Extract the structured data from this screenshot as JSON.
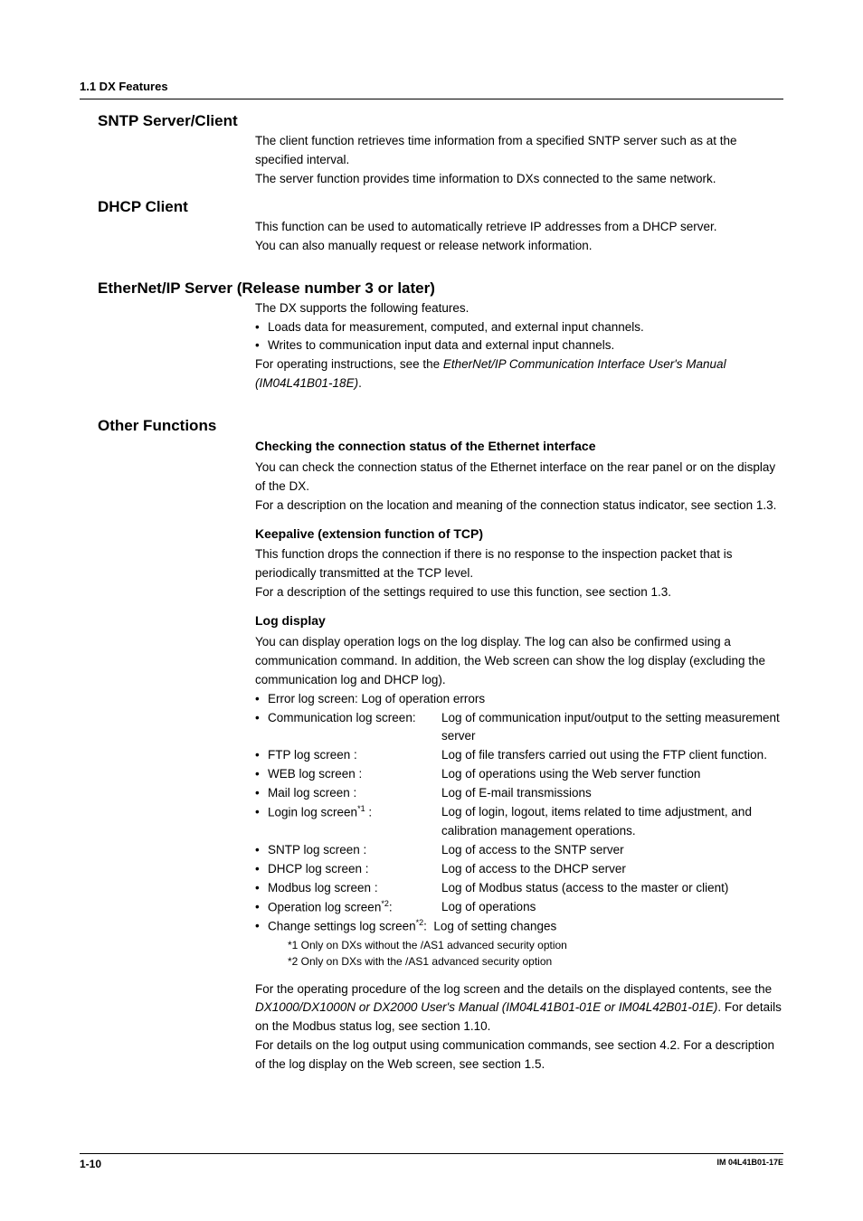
{
  "header": {
    "section_label": "1.1  DX Features"
  },
  "sntp": {
    "title": "SNTP Server/Client",
    "p1": "The client function retrieves time information from a specified SNTP server such as at the specified interval.",
    "p2": "The server function provides time information to DXs connected to the same network."
  },
  "dhcp": {
    "title": "DHCP Client",
    "p1": "This function can be used to automatically retrieve IP addresses from a DHCP server.",
    "p2": "You can also manually request or release network information."
  },
  "ethernet": {
    "title": "EtherNet/IP Server (Release number 3 or later)",
    "intro": "The DX supports the following features.",
    "b1": "Loads data for measurement, computed, and external input channels.",
    "b2": "Writes to communication input data and external input channels.",
    "note_pre": "For operating instructions, see the ",
    "note_em": "EtherNet/IP Communication Interface User's Manual (IM04L41B01-18E)",
    "note_post": "."
  },
  "other": {
    "title": "Other Functions",
    "conn": {
      "h": "Checking the connection status of the Ethernet interface",
      "p1": "You can check the connection status of the Ethernet interface on the rear panel or on the display of the DX.",
      "p2": "For a description on the location and meaning of the connection status indicator, see section 1.3."
    },
    "keep": {
      "h": "Keepalive (extension function of TCP)",
      "p1": "This function drops the connection if there is no response to the inspection packet that is periodically transmitted at the TCP level.",
      "p2": "For a description of the settings required to use this function, see section 1.3."
    },
    "log": {
      "h": "Log display",
      "p1": "You can display operation logs on the log display.  The log can also be confirmed using a communication command.  In addition, the Web screen can show the log display (excluding the communication log and DHCP log).",
      "items": [
        {
          "label": "Error log screen: Log of operation errors",
          "desc": ""
        },
        {
          "label": "Communication log screen:",
          "desc": "Log of communication input/output to the setting measurement server"
        },
        {
          "label": "FTP log screen :",
          "desc": "Log of file transfers carried out using the FTP client function."
        },
        {
          "label": "WEB log screen :",
          "desc": "Log of operations using the Web server function"
        },
        {
          "label": "Mail log screen :",
          "desc": "Log of E-mail transmissions"
        },
        {
          "label": "Login log screen",
          "sup": "*1",
          "label_after": " :",
          "desc": "Log of login, logout, items related to time adjustment, and calibration management operations."
        },
        {
          "label": "SNTP log screen :",
          "desc": "Log of access to the SNTP server"
        },
        {
          "label": "DHCP log screen :",
          "desc": "Log of access to the DHCP server"
        },
        {
          "label": "Modbus log screen :",
          "desc": "Log of Modbus status (access to the master or client)"
        },
        {
          "label": "Operation log screen",
          "sup": "*2",
          "label_after": ":",
          "desc": "Log of operations"
        },
        {
          "label": "Change settings log screen",
          "sup": "*2",
          "label_after": ":",
          "desc_inline": "Log of setting changes"
        }
      ],
      "fn1": "*1  Only on DXs without the /AS1 advanced security option",
      "fn2": "*2  Only on DXs with the /AS1 advanced security option",
      "p2_pre": "For the operating procedure of the log screen and the details on the displayed contents, see the ",
      "p2_em": "DX1000/DX1000N or DX2000 User's Manual (IM04L41B01-01E or IM04L42B01-01E)",
      "p2_post": ".  For details on the Modbus status log, see section 1.10.",
      "p3": "For details on the log output using communication commands, see section 4.2.  For a description of the log display on the Web screen, see section 1.5."
    }
  },
  "footer": {
    "page": "1-10",
    "doc": "IM 04L41B01-17E"
  }
}
